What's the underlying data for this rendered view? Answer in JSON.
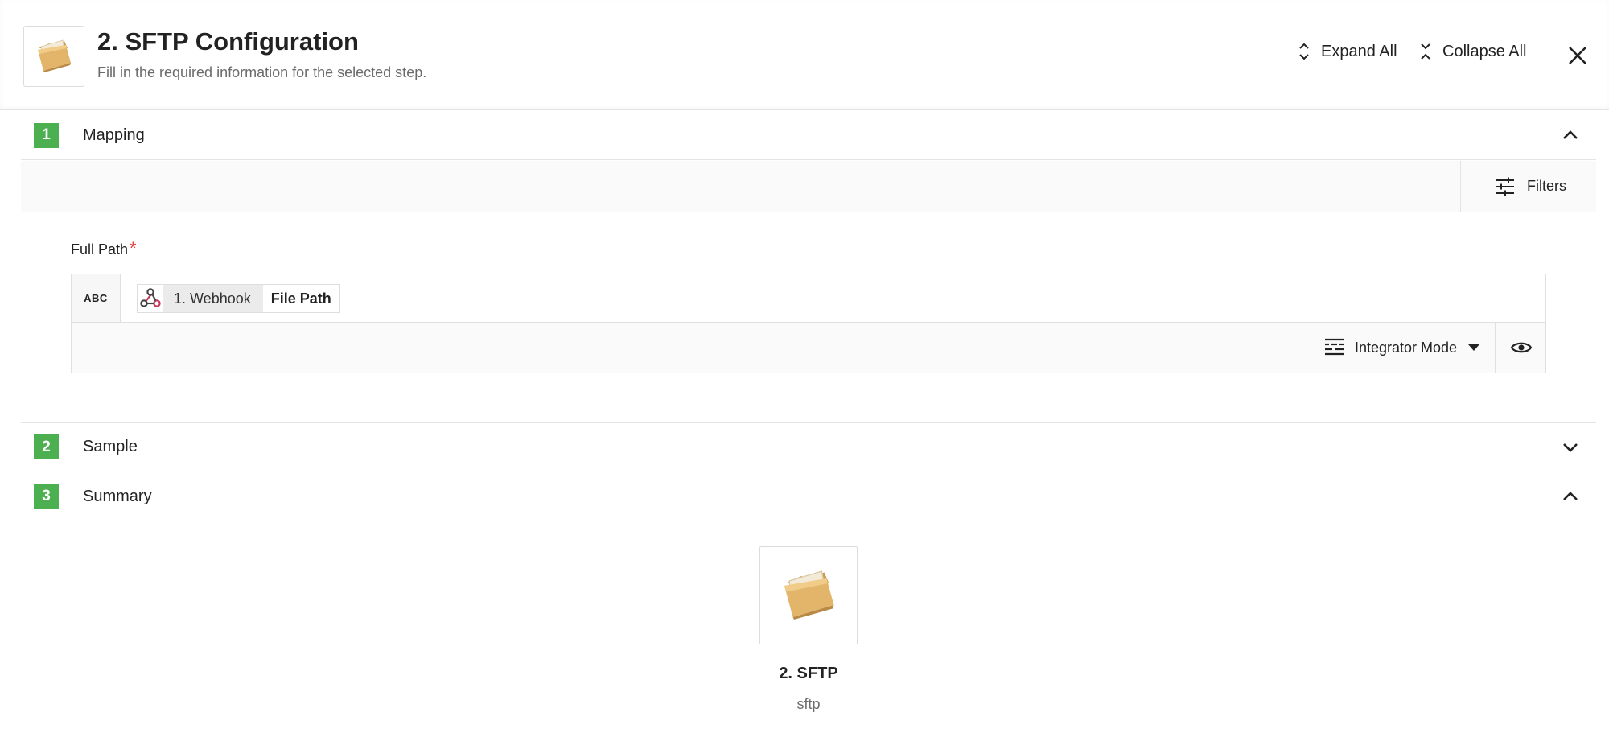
{
  "header": {
    "title": "2. SFTP Configuration",
    "subtitle": "Fill in the required information for the selected step.",
    "icon": "folder-icon",
    "expand_all_label": "Expand All",
    "collapse_all_label": "Collapse All",
    "close_icon": "close-icon"
  },
  "sections": [
    {
      "number": "1",
      "label": "Mapping",
      "expanded": true
    },
    {
      "number": "2",
      "label": "Sample",
      "expanded": false
    },
    {
      "number": "3",
      "label": "Summary",
      "expanded": true
    }
  ],
  "mapping": {
    "filters_label": "Filters",
    "field": {
      "label": "Full Path",
      "required_mark": "*",
      "type_label": "ABC",
      "token_source": "1. Webhook",
      "token_field": "File Path",
      "token_icon": "webhook-icon",
      "mode_label": "Integrator Mode",
      "mode_icon": "list-format-icon",
      "preview_icon": "eye-icon"
    }
  },
  "summary": {
    "step_title": "2. SFTP",
    "step_subtitle": "sftp",
    "icon": "folder-icon"
  },
  "colors": {
    "badge_green": "#4caf50",
    "required_red": "#e53935",
    "border": "#e4e4e4"
  }
}
